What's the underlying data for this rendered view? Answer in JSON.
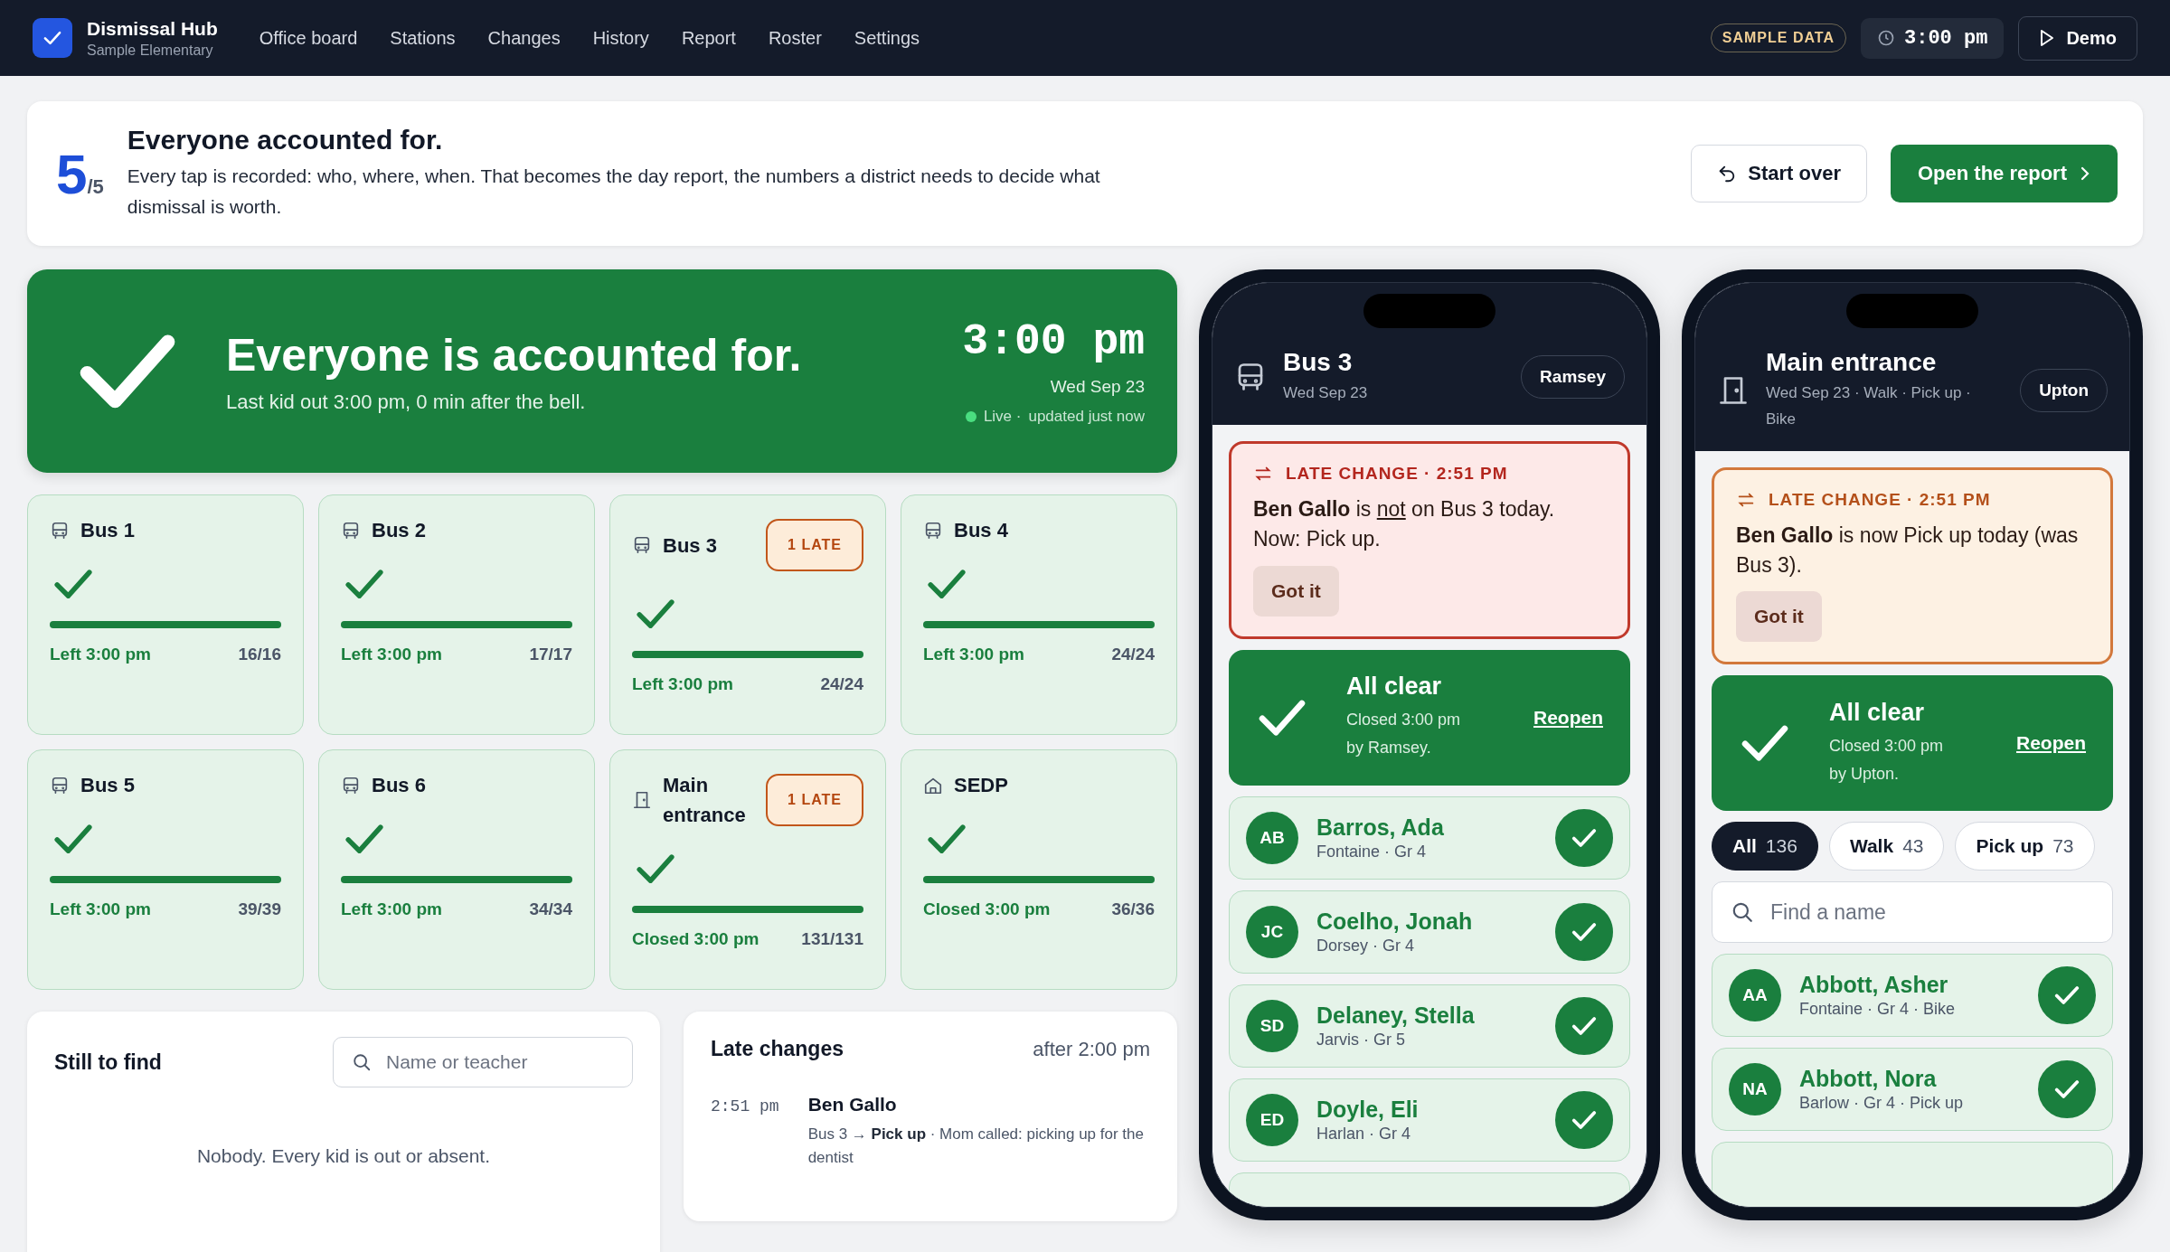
{
  "app": {
    "name": "Dismissal Hub",
    "school": "Sample Elementary"
  },
  "nav": [
    "Office board",
    "Stations",
    "Changes",
    "History",
    "Report",
    "Roster",
    "Settings"
  ],
  "header": {
    "badge": "SAMPLE DATA",
    "clock": "3:00 pm",
    "demo": "Demo"
  },
  "summary": {
    "count": "5",
    "total": "/5",
    "title": "Everyone accounted for.",
    "text": "Every tap is recorded: who, where, when. That becomes the day report, the numbers a district needs to decide what dismissal is worth.",
    "start_over": "Start over",
    "open_report": "Open the report"
  },
  "hero": {
    "title": "Everyone is accounted for.",
    "subtitle": "Last kid out 3:00 pm, 0 min after the bell.",
    "time": "3:00 pm",
    "date": "Wed Sep 23",
    "live": "Live ·",
    "updated": "updated just now"
  },
  "stations": [
    {
      "kind": "bus",
      "name": "Bus 1",
      "status": "Left 3:00 pm",
      "count": "16/16",
      "level": 1
    },
    {
      "kind": "bus",
      "name": "Bus 2",
      "status": "Left 3:00 pm",
      "count": "17/17",
      "level": 1
    },
    {
      "kind": "bus",
      "name": "Bus 3",
      "badge": "1 LATE",
      "status": "Left 3:00 pm",
      "count": "24/24",
      "level": 1
    },
    {
      "kind": "bus",
      "name": "Bus 4",
      "status": "Left 3:00 pm",
      "count": "24/24",
      "level": 1
    },
    {
      "kind": "bus",
      "name": "Bus 5",
      "status": "Left 3:00 pm",
      "count": "39/39",
      "level": 1
    },
    {
      "kind": "bus",
      "name": "Bus 6",
      "status": "Left 3:00 pm",
      "count": "34/34",
      "level": 1
    },
    {
      "kind": "door",
      "name": "Main entrance",
      "badge": "1 LATE",
      "status": "Closed 3:00 pm",
      "count": "131/131",
      "level": 1
    },
    {
      "kind": "home",
      "name": "SEDP",
      "status": "Closed 3:00 pm",
      "count": "36/36",
      "level": 1
    }
  ],
  "still_to_find": {
    "title": "Still to find",
    "placeholder": "Name or teacher",
    "empty": "Nobody. Every kid is out or absent."
  },
  "late_changes": {
    "title": "Late changes",
    "since": "after 2:00 pm",
    "items": [
      {
        "time": "2:51 pm",
        "name": "Ben Gallo",
        "detail": "Bus 3 → **Pick up** · Mom called: picking up for the dentist"
      }
    ]
  },
  "phones": [
    {
      "kind": "bus",
      "title": "Bus 3",
      "subtitle": "Wed Sep 23",
      "staff": "Ramsey",
      "alert": {
        "kind": "leaving",
        "heading": "LATE CHANGE · 2:51 PM",
        "parts": [
          {
            "text": "Ben Gallo",
            "kind": "name"
          },
          {
            "text": " is ",
            "kind": "text"
          },
          {
            "text": "not",
            "kind": "stress"
          },
          {
            "text": " on Bus 3 today. Now: Pick up.",
            "kind": "text"
          }
        ],
        "button": "Got it"
      },
      "all_clear": {
        "title": "All clear",
        "closed": "Closed 3:00 pm",
        "by": "by Ramsey.",
        "link": "Reopen"
      },
      "students": [
        {
          "initials": "AB",
          "name": "Barros, Ada",
          "detail": "Fontaine · Gr 4",
          "checked": true
        },
        {
          "initials": "JC",
          "name": "Coelho, Jonah",
          "detail": "Dorsey · Gr 4",
          "checked": true
        },
        {
          "initials": "SD",
          "name": "Delaney, Stella",
          "detail": "Jarvis · Gr 5",
          "checked": true
        },
        {
          "initials": "ED",
          "name": "Doyle, Eli",
          "detail": "Harlan · Gr 4",
          "checked": true
        }
      ]
    },
    {
      "kind": "door",
      "title": "Main entrance",
      "subtitle": "Wed Sep 23 · Walk · Pick up · Bike",
      "staff": "Upton",
      "alert": {
        "kind": "joining",
        "heading": "LATE CHANGE · 2:51 PM",
        "parts": [
          {
            "text": "Ben Gallo",
            "kind": "name"
          },
          {
            "text": " is now Pick up today (was Bus 3).",
            "kind": "text"
          }
        ],
        "button": "Got it"
      },
      "all_clear": {
        "title": "All clear",
        "closed": "Closed 3:00 pm",
        "by": "by Upton.",
        "link": "Reopen"
      },
      "filters": [
        {
          "label": "All",
          "count": "136",
          "selected": true
        },
        {
          "label": "Walk",
          "count": "43",
          "selected": false
        },
        {
          "label": "Pick up",
          "count": "73",
          "selected": false
        }
      ],
      "search": {
        "placeholder": "Find a name"
      },
      "students": [
        {
          "initials": "AA",
          "name": "Abbott, Asher",
          "detail": "Fontaine · Gr 4 · Bike",
          "checked": true
        },
        {
          "initials": "NA",
          "name": "Abbott, Nora",
          "detail": "Barlow · Gr 4 · Pick up",
          "checked": true
        }
      ]
    }
  ]
}
